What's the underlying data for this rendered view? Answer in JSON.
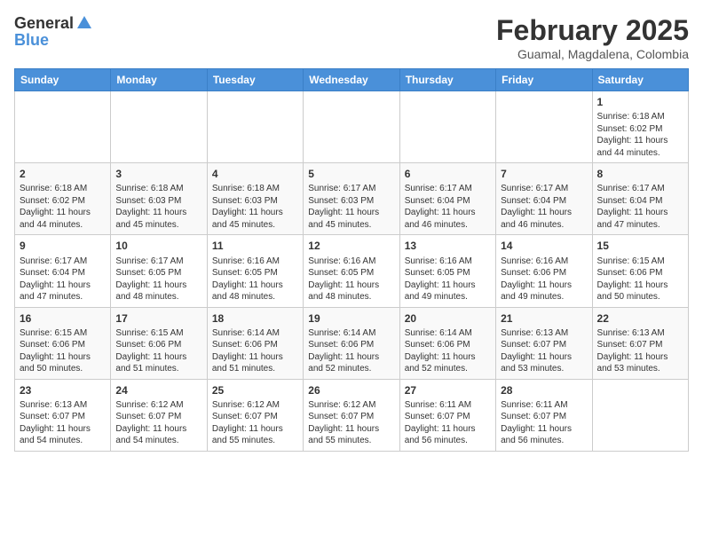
{
  "header": {
    "logo_general": "General",
    "logo_blue": "Blue",
    "month_year": "February 2025",
    "location": "Guamal, Magdalena, Colombia"
  },
  "days_of_week": [
    "Sunday",
    "Monday",
    "Tuesday",
    "Wednesday",
    "Thursday",
    "Friday",
    "Saturday"
  ],
  "weeks": [
    {
      "days": [
        {
          "num": "",
          "info": ""
        },
        {
          "num": "",
          "info": ""
        },
        {
          "num": "",
          "info": ""
        },
        {
          "num": "",
          "info": ""
        },
        {
          "num": "",
          "info": ""
        },
        {
          "num": "",
          "info": ""
        },
        {
          "num": "1",
          "info": "Sunrise: 6:18 AM\nSunset: 6:02 PM\nDaylight: 11 hours\nand 44 minutes."
        }
      ]
    },
    {
      "days": [
        {
          "num": "2",
          "info": "Sunrise: 6:18 AM\nSunset: 6:02 PM\nDaylight: 11 hours\nand 44 minutes."
        },
        {
          "num": "3",
          "info": "Sunrise: 6:18 AM\nSunset: 6:03 PM\nDaylight: 11 hours\nand 45 minutes."
        },
        {
          "num": "4",
          "info": "Sunrise: 6:18 AM\nSunset: 6:03 PM\nDaylight: 11 hours\nand 45 minutes."
        },
        {
          "num": "5",
          "info": "Sunrise: 6:17 AM\nSunset: 6:03 PM\nDaylight: 11 hours\nand 45 minutes."
        },
        {
          "num": "6",
          "info": "Sunrise: 6:17 AM\nSunset: 6:04 PM\nDaylight: 11 hours\nand 46 minutes."
        },
        {
          "num": "7",
          "info": "Sunrise: 6:17 AM\nSunset: 6:04 PM\nDaylight: 11 hours\nand 46 minutes."
        },
        {
          "num": "8",
          "info": "Sunrise: 6:17 AM\nSunset: 6:04 PM\nDaylight: 11 hours\nand 47 minutes."
        }
      ]
    },
    {
      "days": [
        {
          "num": "9",
          "info": "Sunrise: 6:17 AM\nSunset: 6:04 PM\nDaylight: 11 hours\nand 47 minutes."
        },
        {
          "num": "10",
          "info": "Sunrise: 6:17 AM\nSunset: 6:05 PM\nDaylight: 11 hours\nand 48 minutes."
        },
        {
          "num": "11",
          "info": "Sunrise: 6:16 AM\nSunset: 6:05 PM\nDaylight: 11 hours\nand 48 minutes."
        },
        {
          "num": "12",
          "info": "Sunrise: 6:16 AM\nSunset: 6:05 PM\nDaylight: 11 hours\nand 48 minutes."
        },
        {
          "num": "13",
          "info": "Sunrise: 6:16 AM\nSunset: 6:05 PM\nDaylight: 11 hours\nand 49 minutes."
        },
        {
          "num": "14",
          "info": "Sunrise: 6:16 AM\nSunset: 6:06 PM\nDaylight: 11 hours\nand 49 minutes."
        },
        {
          "num": "15",
          "info": "Sunrise: 6:15 AM\nSunset: 6:06 PM\nDaylight: 11 hours\nand 50 minutes."
        }
      ]
    },
    {
      "days": [
        {
          "num": "16",
          "info": "Sunrise: 6:15 AM\nSunset: 6:06 PM\nDaylight: 11 hours\nand 50 minutes."
        },
        {
          "num": "17",
          "info": "Sunrise: 6:15 AM\nSunset: 6:06 PM\nDaylight: 11 hours\nand 51 minutes."
        },
        {
          "num": "18",
          "info": "Sunrise: 6:14 AM\nSunset: 6:06 PM\nDaylight: 11 hours\nand 51 minutes."
        },
        {
          "num": "19",
          "info": "Sunrise: 6:14 AM\nSunset: 6:06 PM\nDaylight: 11 hours\nand 52 minutes."
        },
        {
          "num": "20",
          "info": "Sunrise: 6:14 AM\nSunset: 6:06 PM\nDaylight: 11 hours\nand 52 minutes."
        },
        {
          "num": "21",
          "info": "Sunrise: 6:13 AM\nSunset: 6:07 PM\nDaylight: 11 hours\nand 53 minutes."
        },
        {
          "num": "22",
          "info": "Sunrise: 6:13 AM\nSunset: 6:07 PM\nDaylight: 11 hours\nand 53 minutes."
        }
      ]
    },
    {
      "days": [
        {
          "num": "23",
          "info": "Sunrise: 6:13 AM\nSunset: 6:07 PM\nDaylight: 11 hours\nand 54 minutes."
        },
        {
          "num": "24",
          "info": "Sunrise: 6:12 AM\nSunset: 6:07 PM\nDaylight: 11 hours\nand 54 minutes."
        },
        {
          "num": "25",
          "info": "Sunrise: 6:12 AM\nSunset: 6:07 PM\nDaylight: 11 hours\nand 55 minutes."
        },
        {
          "num": "26",
          "info": "Sunrise: 6:12 AM\nSunset: 6:07 PM\nDaylight: 11 hours\nand 55 minutes."
        },
        {
          "num": "27",
          "info": "Sunrise: 6:11 AM\nSunset: 6:07 PM\nDaylight: 11 hours\nand 56 minutes."
        },
        {
          "num": "28",
          "info": "Sunrise: 6:11 AM\nSunset: 6:07 PM\nDaylight: 11 hours\nand 56 minutes."
        },
        {
          "num": "",
          "info": ""
        }
      ]
    }
  ]
}
